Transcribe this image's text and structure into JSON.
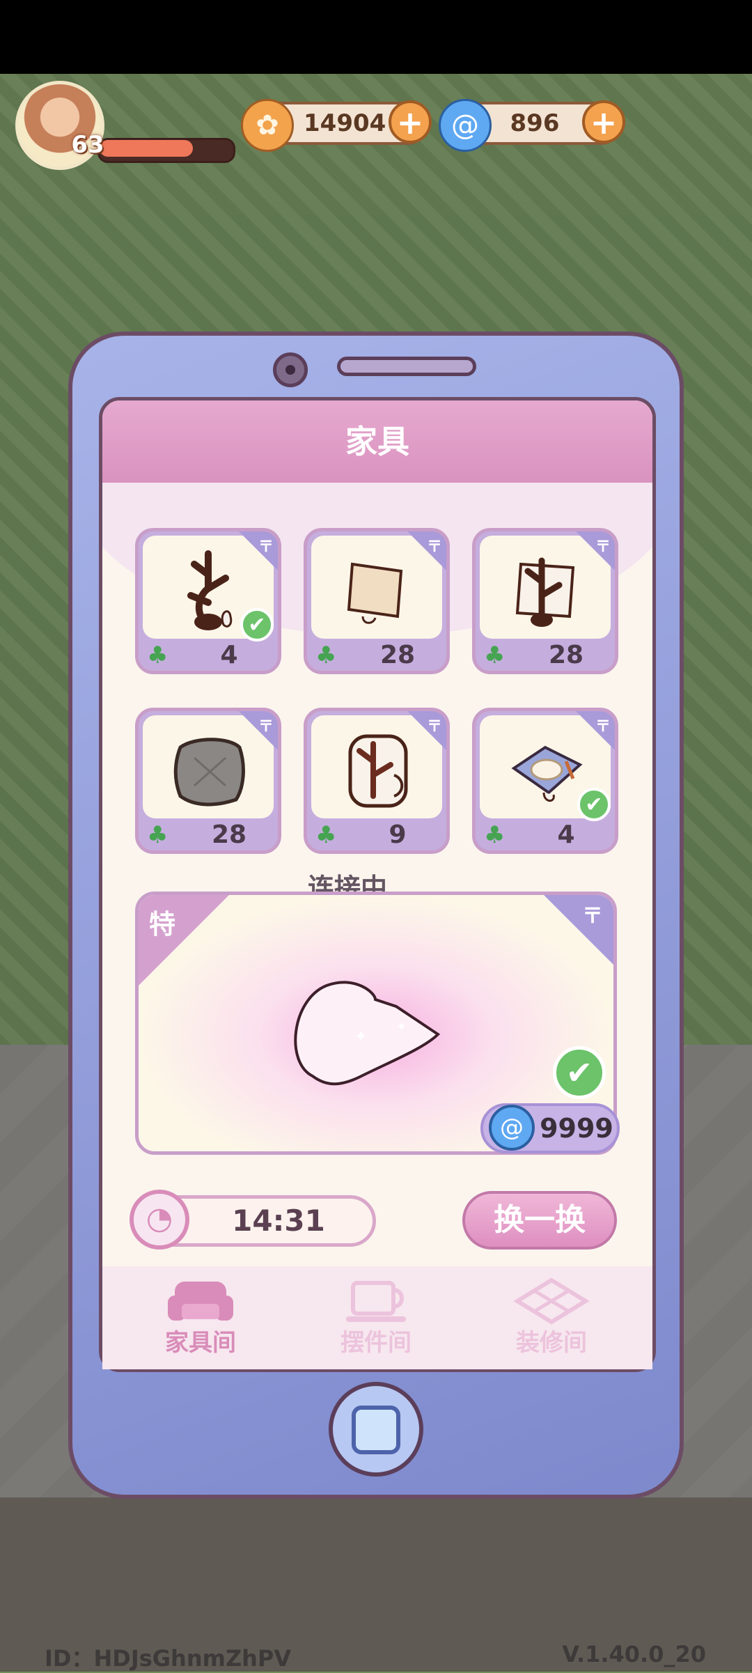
{
  "hud": {
    "level": "63",
    "xp_fraction": 0.72,
    "gold": {
      "value": "14904",
      "icon": "gold-coin-icon",
      "plus": "+"
    },
    "gems": {
      "value": "896",
      "icon": "blue-swirl-icon",
      "plus": "+"
    }
  },
  "panel": {
    "title": "家具",
    "connecting_text": "连接中",
    "items": [
      {
        "icon": "antler-decor-icon",
        "count": "4",
        "owned": true
      },
      {
        "icon": "pillow-icon",
        "count": "28",
        "owned": false
      },
      {
        "icon": "antler-pillow-icon",
        "count": "28",
        "owned": false
      },
      {
        "icon": "gray-cushion-icon",
        "count": "28",
        "owned": false
      },
      {
        "icon": "antler-plate-icon",
        "count": "9",
        "owned": false
      },
      {
        "icon": "dining-mat-icon",
        "count": "4",
        "owned": true
      }
    ],
    "special": {
      "label": "特",
      "price": "9999",
      "owned": true
    },
    "timer": "14:31",
    "refresh_label": "换一换",
    "tabs": [
      {
        "label": "家具间",
        "icon": "armchair-icon",
        "active": true
      },
      {
        "label": "摆件间",
        "icon": "cup-icon",
        "active": false
      },
      {
        "label": "装修间",
        "icon": "floor-tile-icon",
        "active": false
      }
    ]
  },
  "footer": {
    "id_text": "ID：HDJsGhnmZhPV",
    "version": "V.1.40.0_20"
  },
  "colors": {
    "tab_active": "#d98cb9",
    "tab_inactive": "#ecc3dc",
    "clover": "#46a352",
    "check": "#6cc36a"
  }
}
